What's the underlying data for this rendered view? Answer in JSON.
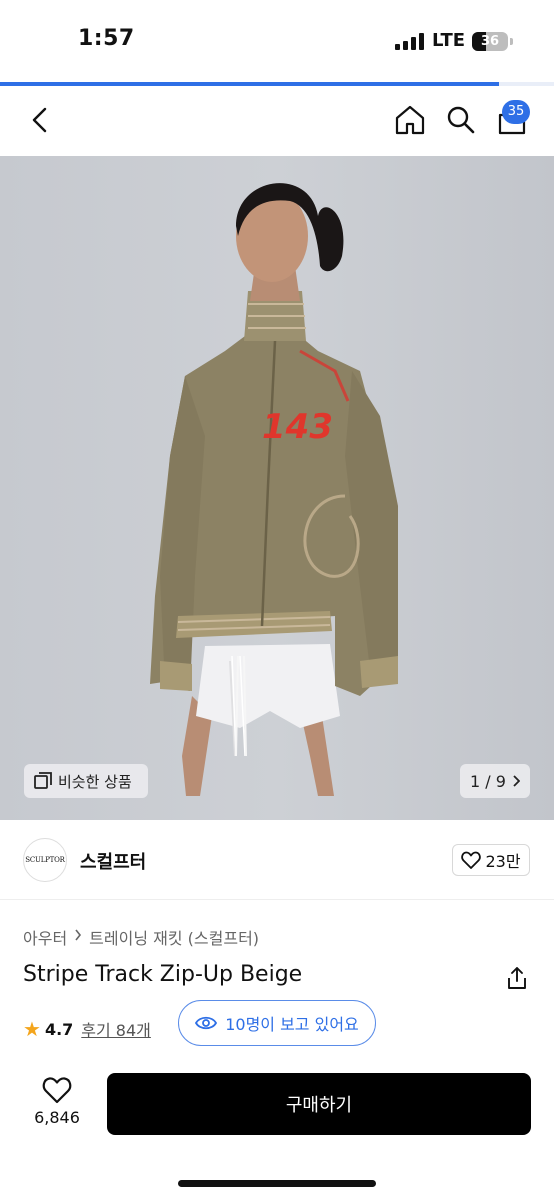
{
  "status": {
    "time": "1:57",
    "network": "LTE",
    "battery": "36"
  },
  "progress": {
    "fraction": 0.9
  },
  "nav": {
    "cart_count": "35"
  },
  "gallery": {
    "similar_label": "비슷한 상품",
    "pager": "1 / 9",
    "jacket_number": "143"
  },
  "brand": {
    "logo_text": "SCULPTOR",
    "name": "스컬프터",
    "likes": "23만"
  },
  "product": {
    "breadcrumb": [
      "아우터",
      "트레이닝 재킷 (스컬프터)"
    ],
    "title": "Stripe Track Zip-Up Beige",
    "rating": "4.7",
    "reviews": "후기 84개",
    "viewers": "10명이 보고 있어요"
  },
  "footer": {
    "fav_count": "6,846",
    "buy_label": "구매하기"
  },
  "colors": {
    "accent": "#2e6fe6",
    "star": "#f4a51c",
    "buy_button": "#000000"
  },
  "icons": [
    "back-icon",
    "home-icon",
    "search-icon",
    "cart-icon",
    "similar-icon",
    "chevron-right-icon",
    "heart-icon",
    "share-icon",
    "star-icon",
    "eye-icon"
  ]
}
